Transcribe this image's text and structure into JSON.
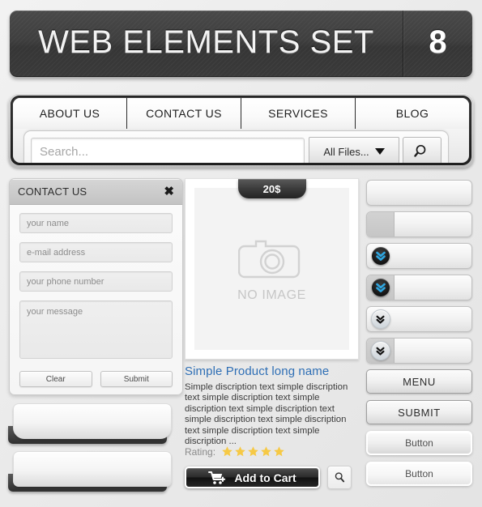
{
  "header": {
    "title": "WEB ELEMENTS SET",
    "number": "8"
  },
  "nav": {
    "tabs": [
      {
        "label": "ABOUT US"
      },
      {
        "label": "CONTACT US"
      },
      {
        "label": "SERVICES"
      },
      {
        "label": "BLOG"
      }
    ]
  },
  "search": {
    "value": "",
    "placeholder": "Search...",
    "filter_label": "All Files...",
    "filter_icon": "caret-down-icon",
    "button_icon": "magnifier-icon"
  },
  "contact_form": {
    "title": "CONTACT US",
    "close_icon": "close-x-icon",
    "fields": [
      {
        "name": "your-name",
        "placeholder": "your name",
        "value": ""
      },
      {
        "name": "email-address",
        "placeholder": "e-mail address",
        "value": ""
      },
      {
        "name": "phone-number",
        "placeholder": "your phone number",
        "value": ""
      }
    ],
    "message": {
      "placeholder": "your message",
      "value": ""
    },
    "clear_label": "Clear",
    "submit_label": "Submit"
  },
  "product": {
    "price_badge": "20$",
    "image_placeholder_text": "NO IMAGE",
    "image_icon": "camera-icon",
    "title": "Simple Product long name",
    "title_color": "#2f6fb5",
    "description": "Simple discription text simple discription text simple discription text simple discription text simple discription text simple discription text simple discription text simple discription text simple discription ...",
    "rating_label": "Rating:",
    "rating_stars": 5,
    "star_color": "#f6c945",
    "add_to_cart_label": "Add to Cart",
    "cart_icon": "cart-plus-icon",
    "search_icon": "magnifier-icon"
  },
  "right_column": {
    "bars": [
      {
        "name": "bar-plain",
        "has_left_segment": false,
        "icon": null
      },
      {
        "name": "bar-split",
        "has_left_segment": true,
        "icon": null
      },
      {
        "name": "bar-chevron-blue",
        "has_left_segment": false,
        "icon": "double-chevron-down-icon"
      },
      {
        "name": "bar-split-chevron-blue",
        "has_left_segment": true,
        "icon": "double-chevron-down-icon"
      },
      {
        "name": "bar-chevron-gray",
        "has_left_segment": false,
        "icon": "double-chevron-down-icon"
      },
      {
        "name": "bar-split-chevron-gray",
        "has_left_segment": true,
        "icon": "double-chevron-down-icon"
      }
    ],
    "buttons": [
      {
        "name": "menu-button",
        "label": "MENU"
      },
      {
        "name": "submit-button",
        "label": "SUBMIT"
      },
      {
        "name": "generic-button-1",
        "label": "Button"
      },
      {
        "name": "generic-button-2",
        "label": "Button"
      }
    ],
    "chevron_blue": "#2fa6e0"
  },
  "panels": [
    {
      "name": "blank-panel-top"
    },
    {
      "name": "blank-panel-bottom"
    }
  ]
}
